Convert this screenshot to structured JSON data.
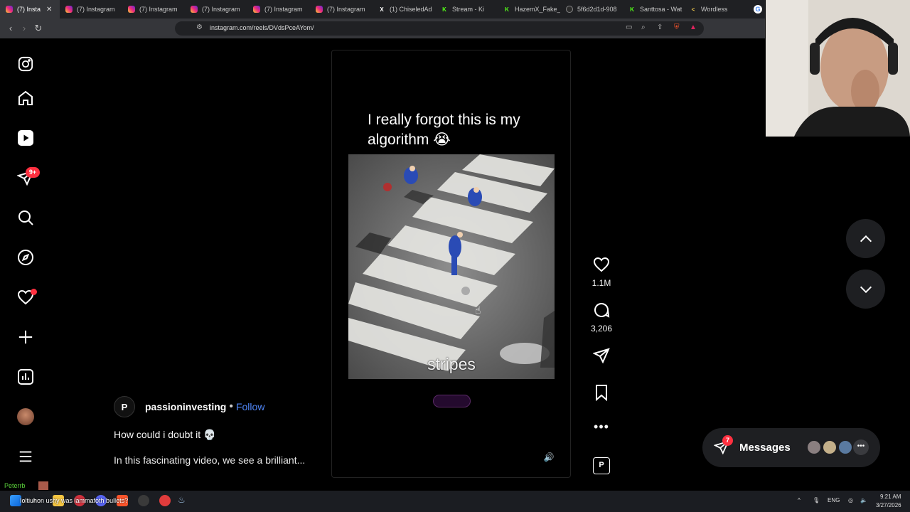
{
  "browser": {
    "tabs": [
      {
        "label": "(7) Insta",
        "icon": "instagram-icon",
        "active": true
      },
      {
        "label": "(7) Instagram",
        "icon": "instagram-icon"
      },
      {
        "label": "(7) Instagram",
        "icon": "instagram-icon"
      },
      {
        "label": "(7) Instagram",
        "icon": "instagram-icon"
      },
      {
        "label": "(7) Instagram",
        "icon": "instagram-icon"
      },
      {
        "label": "(7) Instagram",
        "icon": "instagram-icon"
      },
      {
        "label": "(1) ChiseledAd",
        "icon": "x-icon"
      },
      {
        "label": "Stream - Ki",
        "icon": "kick-icon"
      },
      {
        "label": "HazemX_Fake_",
        "icon": "kick-icon"
      },
      {
        "label": "5f6d2d1d-908",
        "icon": "github-icon"
      },
      {
        "label": "Santtosa - Wat",
        "icon": "kick-icon"
      },
      {
        "label": "Wordless",
        "icon": "wordless-icon"
      }
    ],
    "url": "instagram.com/reels/DVdsPceAYom/"
  },
  "sidebar": {
    "notifications_badge": "9+"
  },
  "reel": {
    "overlay_caption": "I really forgot this is my algorithm 😭",
    "subtitle": "stripes",
    "likes": "1.1M",
    "comments": "3,206"
  },
  "author": {
    "username": "passioninvesting",
    "separator": "•",
    "follow_label": "Follow",
    "caption": "How could i doubt it 💀",
    "description": "In this fascinating video, we see a brilliant..."
  },
  "messages": {
    "label": "Messages",
    "badge": "7"
  },
  "taskbar": {
    "chat_name": "Peterrb",
    "chat_overlay_text": "Ioltiuhon ushy was lammafoth bullets?",
    "lang": "ENG",
    "time": "9:21 AM",
    "date": "3/27/2026"
  },
  "colors": {
    "accent_link": "#4f86f7",
    "badge_red": "#ff3040",
    "page_bg": "#000000"
  }
}
